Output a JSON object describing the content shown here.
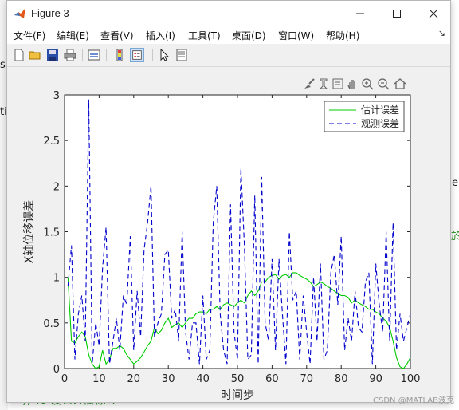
{
  "window": {
    "title": "Figure 3"
  },
  "menu": [
    "文件(F)",
    "编辑(E)",
    "查看(V)",
    "插入(I)",
    "工具(T)",
    "桌面(D)",
    "窗口(W)",
    "帮助(H)"
  ],
  "background": {
    "left_fragments": [
      "s",
      "ti"
    ],
    "right_fragments": [
      "e",
      "於"
    ],
    "bottom_code": "), % 设置X轴标签",
    "watermark": "CSDN @MATLAB波克"
  },
  "toolbar_icons": [
    "new-figure-icon",
    "open-file-icon",
    "save-icon",
    "print-icon",
    "link-plot-icon",
    "insert-colorbar-icon",
    "insert-legend-icon",
    "edit-plot-icon",
    "property-inspector-icon"
  ],
  "axes_toolbar_icons": [
    "brush-icon",
    "data-tips-icon",
    "pan-icon",
    "zoom-in-icon",
    "zoom-out-icon",
    "restore-view-icon",
    "export-icon"
  ],
  "chart_data": {
    "type": "line",
    "title": "",
    "xlabel": "时间步",
    "ylabel": "X轴位移误差",
    "xlim": [
      0,
      100
    ],
    "ylim": [
      0,
      3
    ],
    "xticks": [
      0,
      10,
      20,
      30,
      40,
      50,
      60,
      70,
      80,
      90,
      100
    ],
    "yticks": [
      0,
      0.5,
      1,
      1.5,
      2,
      2.5,
      3
    ],
    "grid": false,
    "legend_position": "top-right",
    "series": [
      {
        "name": "估计误差",
        "color": "#00cc00",
        "style": "solid",
        "x": [
          1,
          2,
          3,
          4,
          5,
          6,
          7,
          8,
          9,
          10,
          11,
          12,
          13,
          14,
          15,
          16,
          17,
          18,
          19,
          20,
          21,
          22,
          23,
          24,
          25,
          26,
          27,
          28,
          29,
          30,
          31,
          32,
          33,
          34,
          35,
          36,
          37,
          38,
          39,
          40,
          41,
          42,
          43,
          44,
          45,
          46,
          47,
          48,
          49,
          50,
          51,
          52,
          53,
          54,
          55,
          56,
          57,
          58,
          59,
          60,
          61,
          62,
          63,
          64,
          65,
          66,
          67,
          68,
          69,
          70,
          71,
          72,
          73,
          74,
          75,
          76,
          77,
          78,
          79,
          80,
          81,
          82,
          83,
          84,
          85,
          86,
          87,
          88,
          89,
          90,
          91,
          92,
          93,
          94,
          95,
          96,
          97,
          98,
          99,
          100
        ],
        "values": [
          1.0,
          0.3,
          0.28,
          0.35,
          0.4,
          0.35,
          0.15,
          0.05,
          0.0,
          0.02,
          0.2,
          0.05,
          0.1,
          0.22,
          0.22,
          0.25,
          0.22,
          0.15,
          0.1,
          0.05,
          0.08,
          0.12,
          0.18,
          0.25,
          0.3,
          0.45,
          0.38,
          0.42,
          0.5,
          0.55,
          0.45,
          0.48,
          0.5,
          0.45,
          0.5,
          0.55,
          0.55,
          0.6,
          0.62,
          0.62,
          0.6,
          0.65,
          0.65,
          0.68,
          0.65,
          0.7,
          0.72,
          0.7,
          0.68,
          0.72,
          0.75,
          0.72,
          0.8,
          0.85,
          0.8,
          0.85,
          0.95,
          0.95,
          1.0,
          1.02,
          1.03,
          0.98,
          1.02,
          1.03,
          1.0,
          1.05,
          1.05,
          1.02,
          1.0,
          0.98,
          0.95,
          0.9,
          0.92,
          0.95,
          0.93,
          0.9,
          0.88,
          0.85,
          0.82,
          0.8,
          0.8,
          0.78,
          0.72,
          0.75,
          0.72,
          0.7,
          0.68,
          0.65,
          0.65,
          0.62,
          0.6,
          0.55,
          0.52,
          0.45,
          0.3,
          0.12,
          0.02,
          0.0,
          0.05,
          0.12
        ]
      },
      {
        "name": "观测误差",
        "color": "#0000cc",
        "style": "dashed",
        "x": [
          1,
          2,
          3,
          4,
          5,
          6,
          7,
          8,
          9,
          10,
          11,
          12,
          13,
          14,
          15,
          16,
          17,
          18,
          19,
          20,
          21,
          22,
          23,
          24,
          25,
          26,
          27,
          28,
          29,
          30,
          31,
          32,
          33,
          34,
          35,
          36,
          37,
          38,
          39,
          40,
          41,
          42,
          43,
          44,
          45,
          46,
          47,
          48,
          49,
          50,
          51,
          52,
          53,
          54,
          55,
          56,
          57,
          58,
          59,
          60,
          61,
          62,
          63,
          64,
          65,
          66,
          67,
          68,
          69,
          70,
          71,
          72,
          73,
          74,
          75,
          76,
          77,
          78,
          79,
          80,
          81,
          82,
          83,
          84,
          85,
          86,
          87,
          88,
          89,
          90,
          91,
          92,
          93,
          94,
          95,
          96,
          97,
          98,
          99,
          100
        ],
        "values": [
          0.9,
          1.35,
          0.1,
          0.6,
          0.8,
          0.3,
          2.95,
          0.05,
          0.5,
          0.25,
          1.1,
          1.55,
          0.05,
          0.3,
          0.55,
          0.2,
          0.8,
          0.7,
          1.45,
          0.2,
          0.85,
          0.35,
          1.3,
          1.6,
          2.0,
          0.35,
          0.5,
          0.6,
          1.25,
          1.3,
          0.55,
          0.65,
          0.3,
          1.5,
          0.4,
          0.1,
          0.5,
          0.5,
          0.05,
          0.8,
          0.1,
          0.2,
          1.6,
          2.0,
          0.6,
          0.2,
          0.05,
          1.8,
          0.4,
          0.1,
          2.2,
          1.35,
          0.1,
          0.15,
          1.9,
          0.05,
          2.1,
          0.5,
          0.3,
          1.2,
          0.2,
          1.2,
          0.6,
          0.05,
          1.5,
          0.75,
          0.85,
          0.1,
          0.8,
          0.4,
          0.05,
          1.0,
          0.3,
          1.15,
          0.1,
          0.2,
          1.05,
          1.25,
          0.7,
          1.45,
          0.2,
          0.55,
          0.3,
          0.85,
          0.45,
          0.4,
          0.95,
          1.05,
          0.05,
          1.15,
          0.7,
          0.4,
          1.5,
          0.3,
          1.6,
          0.2,
          0.6,
          0.3,
          0.45,
          0.6
        ]
      }
    ]
  }
}
